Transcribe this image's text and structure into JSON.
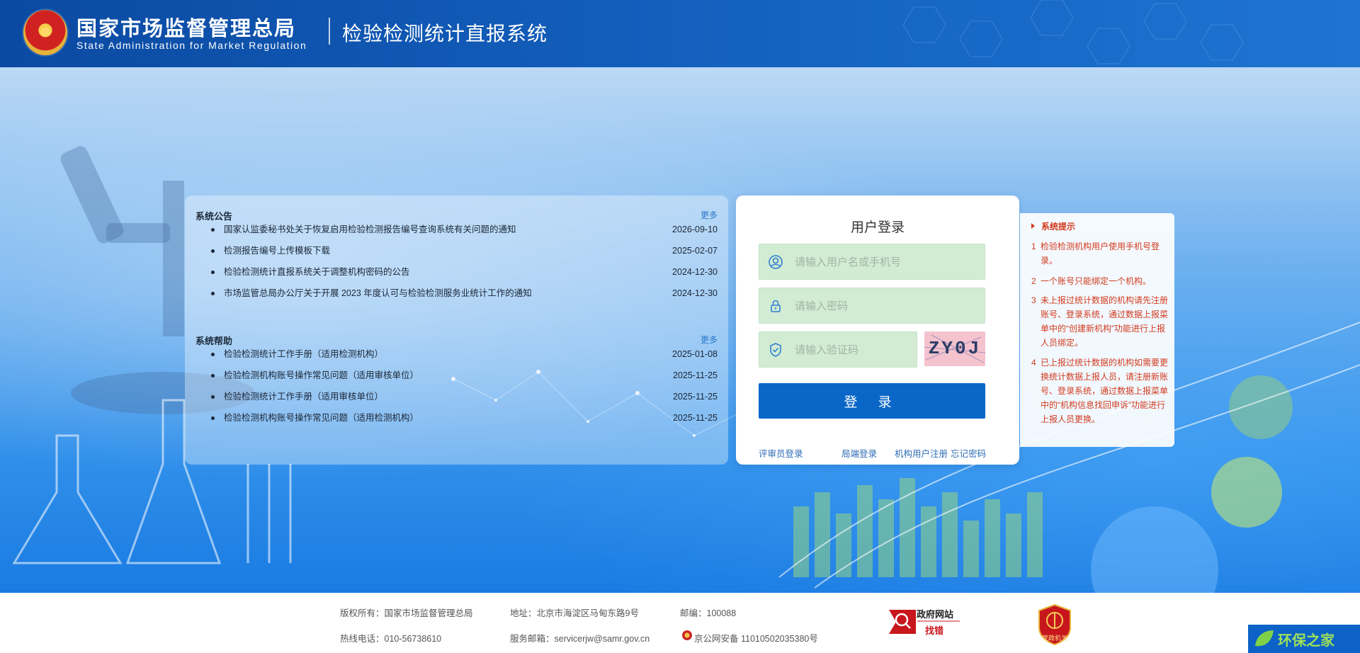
{
  "header": {
    "org_cn": "国家市场监督管理总局",
    "org_en": "State Administration  for  Market Regulation",
    "system_title": "检验检测统计直报系统"
  },
  "announcements": {
    "title": "系统公告",
    "more": "更多",
    "items": [
      {
        "title": "国家认监委秘书处关于恢复启用检验检测报告编号查询系统有关问题的通知",
        "date": "2026-09-10"
      },
      {
        "title": "检测报告编号上传模板下载",
        "date": "2025-02-07"
      },
      {
        "title": "检验检测统计直报系统关于调整机构密码的公告",
        "date": "2024-12-30"
      },
      {
        "title": "市场监管总局办公厅关于开展 2023 年度认可与检验检测服务业统计工作的通知",
        "date": "2024-12-30"
      }
    ]
  },
  "help": {
    "title": "系统帮助",
    "more": "更多",
    "items": [
      {
        "title": "检验检测统计工作手册（适用检测机构）",
        "date": "2025-01-08"
      },
      {
        "title": "检验检测机构账号操作常见问题（适用审核单位）",
        "date": "2025-11-25"
      },
      {
        "title": "检验检测统计工作手册（适用审核单位）",
        "date": "2025-11-25"
      },
      {
        "title": "检验检测机构账号操作常见问题（适用检测机构）",
        "date": "2025-11-25"
      }
    ]
  },
  "login": {
    "title": "用户登录",
    "username_placeholder": "请输入用户名或手机号",
    "password_placeholder": "请输入密码",
    "captcha_placeholder": "请输入验证码",
    "captcha_text": "ZY0J",
    "submit": "登 录",
    "links": {
      "reviewer": "评审员登录",
      "bureau": "局端登录",
      "register": "机构用户注册",
      "forgot": "忘记密码"
    }
  },
  "tips": {
    "title": "系统提示",
    "items": [
      {
        "num": "1",
        "text": "检验检测机构用户使用手机号登录。"
      },
      {
        "num": "2",
        "text": "一个账号只能绑定一个机构。"
      },
      {
        "num": "3",
        "text": "未上报过统计数据的机构请先注册账号、登录系统，通过数据上报菜单中的“创建新机构”功能进行上报人员绑定。"
      },
      {
        "num": "4",
        "text": "已上报过统计数据的机构如需要更换统计数据上报人员，请注册新账号、登录系统，通过数据上报菜单中的“机构信息找回申诉”功能进行上报人员更换。"
      }
    ]
  },
  "footer": {
    "copyright": "版权所有：国家市场监督管理总局",
    "address": "地址：北京市海淀区马甸东路9号",
    "postcode": "邮编：100088",
    "hotline": "热线电话：010-56738610",
    "email": "服务邮箱：servicerjw@samr.gov.cn",
    "icp": "京公网安备 11010502035380号",
    "gov_badge_top": "政府网站",
    "gov_badge_bottom": "找错",
    "party_badge": "党政机关",
    "bottom_logo": "环保之家"
  },
  "colors": {
    "header_blue": "#0b4aa2",
    "button_blue": "#0a67c7",
    "input_green": "#d2ecd3",
    "tip_red": "#d23b1f",
    "link_blue": "#2f6eb6"
  }
}
